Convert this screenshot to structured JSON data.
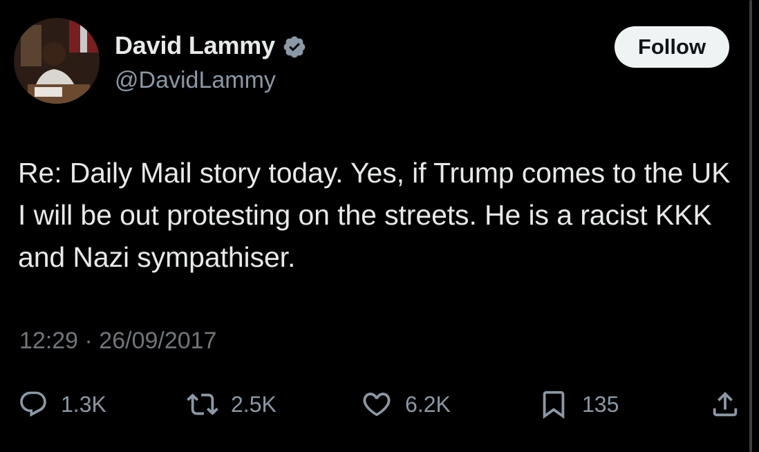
{
  "author": {
    "display_name": "David Lammy",
    "handle": "@DavidLammy",
    "verified_icon": "verified-badge-icon",
    "verified_color": "#8b98a5"
  },
  "follow_button": {
    "label": "Follow"
  },
  "tweet": {
    "text": "Re: Daily Mail story today. Yes, if Trump comes to the UK I will be out protesting on the streets. He is a racist KKK and Nazi sympathiser.",
    "timestamp": "12:29 · 26/09/2017"
  },
  "actions": {
    "replies": {
      "icon": "reply-icon",
      "count": "1.3K"
    },
    "reposts": {
      "icon": "repost-icon",
      "count": "2.5K"
    },
    "likes": {
      "icon": "heart-icon",
      "count": "6.2K"
    },
    "bookmarks": {
      "icon": "bookmark-icon",
      "count": "135"
    },
    "share": {
      "icon": "share-icon"
    }
  },
  "colors": {
    "background": "#000000",
    "text_primary": "#e7e9ea",
    "text_secondary": "#71767b",
    "button_bg": "#eff3f4"
  }
}
